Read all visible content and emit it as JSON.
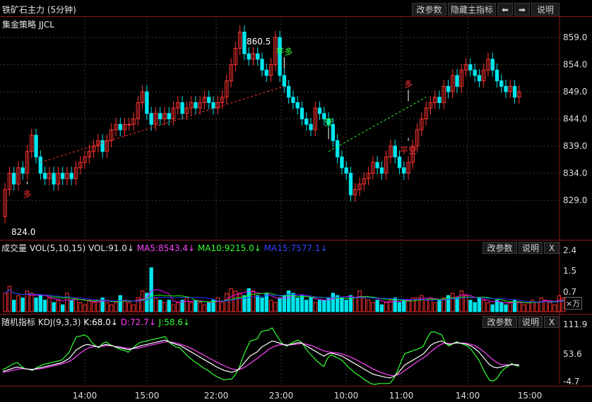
{
  "header": {
    "title": "铁矿石主力 (5分钟)",
    "change_params": "改参数",
    "hide_main": "隐藏主指标",
    "left_arrow": "⬅",
    "right_arrow": "➡",
    "help": "说明"
  },
  "main": {
    "strategy": "集金策略 JJCL",
    "high_label": "860.5",
    "low_label": "824.0",
    "signals": [
      "平多",
      "空",
      "多",
      "平空",
      "多"
    ]
  },
  "volume": {
    "title": "成交量",
    "indicator": "VOL(5,10,15)",
    "vol": "VOL:91.0↓",
    "ma5": "MA5:8543.4↓",
    "ma10": "MA10:9215.0↓",
    "ma15": "MA15:7577.1↓",
    "change_params": "改参数",
    "help": "说明",
    "close": "X",
    "unit": "×万",
    "y_ticks": [
      "2.4",
      "1.5",
      "0.7"
    ]
  },
  "kdj": {
    "title": "随机指标",
    "indicator": "KDJ(9,3,3)",
    "k": "K:68.0↓",
    "d": "D:72.7↓",
    "j": "J:58.6↓",
    "change_params": "改参数",
    "help": "说明",
    "close": "X",
    "y_ticks": [
      "111.9",
      "53.6",
      "-4.7"
    ]
  },
  "colors": {
    "up": "#ff3232",
    "down": "#00e5ee",
    "ma5": "#ff00ff",
    "ma10": "#00ff00",
    "ma15": "#2233ff",
    "k": "#ffffff",
    "d": "#ff44ff",
    "j": "#33ff33",
    "signal_long": "#ff3232",
    "signal_short": "#33ff33"
  },
  "chart_data": {
    "type": "candlestick",
    "x_tick_labels": [
      "14:00",
      "15:00",
      "22:00",
      "23:00",
      "10:00",
      "11:00",
      "14:00",
      "15:00"
    ],
    "y_tick_labels": [
      "859.0",
      "854.0",
      "849.0",
      "844.0",
      "839.0",
      "834.0",
      "829.0"
    ],
    "ylim": [
      822,
      862
    ],
    "candles": [
      [
        826,
        831
      ],
      [
        831,
        834
      ],
      [
        834,
        832
      ],
      [
        832,
        835
      ],
      [
        835,
        834
      ],
      [
        834,
        838
      ],
      [
        838,
        841
      ],
      [
        841,
        837
      ],
      [
        837,
        834
      ],
      [
        834,
        833
      ],
      [
        833,
        834
      ],
      [
        834,
        832
      ],
      [
        832,
        834
      ],
      [
        834,
        833
      ],
      [
        833,
        834
      ],
      [
        834,
        833
      ],
      [
        833,
        835
      ],
      [
        835,
        836
      ],
      [
        836,
        837
      ],
      [
        837,
        838
      ],
      [
        838,
        839
      ],
      [
        839,
        840
      ],
      [
        840,
        838
      ],
      [
        838,
        840
      ],
      [
        840,
        842
      ],
      [
        842,
        843
      ],
      [
        843,
        842
      ],
      [
        842,
        843
      ],
      [
        843,
        843
      ],
      [
        843,
        844
      ],
      [
        844,
        847
      ],
      [
        847,
        849
      ],
      [
        849,
        845
      ],
      [
        845,
        843
      ],
      [
        843,
        845
      ],
      [
        845,
        844
      ],
      [
        844,
        845
      ],
      [
        845,
        844
      ],
      [
        844,
        846
      ],
      [
        846,
        847
      ],
      [
        847,
        845
      ],
      [
        845,
        846
      ],
      [
        846,
        847
      ],
      [
        847,
        846
      ],
      [
        846,
        847
      ],
      [
        847,
        848
      ],
      [
        848,
        847
      ],
      [
        847,
        846
      ],
      [
        846,
        847
      ],
      [
        847,
        848
      ],
      [
        848,
        851
      ],
      [
        851,
        854
      ],
      [
        854,
        857
      ],
      [
        857,
        860
      ],
      [
        860,
        856
      ],
      [
        856,
        855
      ],
      [
        855,
        856
      ],
      [
        856,
        855
      ],
      [
        855,
        853
      ],
      [
        853,
        852
      ],
      [
        852,
        854
      ],
      [
        854,
        859
      ],
      [
        859,
        852
      ],
      [
        852,
        850
      ],
      [
        850,
        848
      ],
      [
        848,
        847
      ],
      [
        847,
        846
      ],
      [
        846,
        844
      ],
      [
        844,
        843
      ],
      [
        843,
        842
      ],
      [
        842,
        846
      ],
      [
        846,
        845
      ],
      [
        845,
        844
      ],
      [
        844,
        843
      ],
      [
        843,
        840
      ],
      [
        840,
        837
      ],
      [
        837,
        835
      ],
      [
        835,
        834
      ],
      [
        834,
        830
      ],
      [
        830,
        831
      ],
      [
        831,
        832
      ],
      [
        832,
        833
      ],
      [
        833,
        834
      ],
      [
        834,
        836
      ],
      [
        836,
        835
      ],
      [
        835,
        834
      ],
      [
        834,
        837
      ],
      [
        837,
        839
      ],
      [
        839,
        837
      ],
      [
        837,
        835
      ],
      [
        835,
        834
      ],
      [
        834,
        836
      ],
      [
        836,
        839
      ],
      [
        839,
        842
      ],
      [
        842,
        844
      ],
      [
        844,
        846
      ],
      [
        846,
        847
      ],
      [
        847,
        848
      ],
      [
        848,
        847
      ],
      [
        847,
        850
      ],
      [
        850,
        849
      ],
      [
        849,
        852
      ],
      [
        852,
        850
      ],
      [
        850,
        853
      ],
      [
        853,
        854
      ],
      [
        854,
        853
      ],
      [
        853,
        852
      ],
      [
        852,
        851
      ],
      [
        851,
        853
      ],
      [
        853,
        855
      ],
      [
        855,
        853
      ],
      [
        853,
        851
      ],
      [
        851,
        850
      ],
      [
        850,
        849
      ],
      [
        849,
        850
      ],
      [
        850,
        848
      ],
      [
        848,
        849
      ]
    ],
    "kdj_k": [
      20,
      22,
      25,
      28,
      30,
      28,
      26,
      25,
      24,
      26,
      28,
      30,
      32,
      34,
      36,
      38,
      40,
      45,
      50,
      60,
      70,
      75,
      80,
      82,
      80,
      78,
      76,
      80,
      82,
      80,
      78,
      76,
      74,
      72,
      70,
      72,
      75,
      78,
      80,
      82,
      84,
      86,
      88,
      90,
      92,
      88,
      85,
      82,
      80,
      75,
      70,
      65,
      60,
      55,
      50,
      45,
      40,
      35,
      30,
      26,
      22,
      20,
      18,
      20,
      25,
      35,
      45,
      55,
      60,
      65,
      75,
      80,
      85,
      90,
      88,
      85,
      82,
      80,
      82,
      84,
      86,
      85,
      80,
      75,
      70,
      65,
      60,
      55,
      60,
      62,
      60,
      58,
      55,
      50,
      45,
      40,
      35,
      30,
      25,
      20,
      15,
      12,
      10,
      8,
      6,
      5,
      8,
      15,
      25,
      35,
      40,
      45,
      50,
      55,
      60,
      70,
      80,
      85,
      88,
      90,
      85,
      82,
      84,
      86,
      85,
      84,
      82,
      78,
      72,
      65,
      55,
      45,
      35,
      30,
      28,
      30,
      32,
      34,
      36,
      35,
      34
    ],
    "kdj_d": [
      18,
      19,
      21,
      23,
      25,
      26,
      26,
      25,
      25,
      25,
      26,
      27,
      29,
      31,
      33,
      35,
      37,
      40,
      43,
      48,
      55,
      62,
      68,
      73,
      76,
      77,
      77,
      78,
      79,
      79,
      78,
      77,
      76,
      74,
      73,
      72,
      73,
      74,
      76,
      78,
      80,
      82,
      84,
      86,
      88,
      88,
      87,
      85,
      83,
      80,
      77,
      73,
      69,
      64,
      60,
      55,
      50,
      46,
      41,
      37,
      33,
      29,
      26,
      24,
      24,
      27,
      32,
      38,
      44,
      50,
      57,
      63,
      70,
      75,
      79,
      81,
      82,
      81,
      81,
      82,
      83,
      84,
      83,
      81,
      78,
      75,
      71,
      67,
      65,
      64,
      63,
      62,
      60,
      57,
      54,
      50,
      46,
      41,
      37,
      32,
      27,
      23,
      19,
      16,
      13,
      11,
      10,
      12,
      16,
      22,
      28,
      34,
      40,
      46,
      51,
      57,
      65,
      72,
      78,
      83,
      85,
      84,
      84,
      85,
      85,
      85,
      84,
      82,
      79,
      74,
      68,
      61,
      53,
      46,
      40,
      36,
      35,
      35,
      35,
      36,
      35
    ],
    "kdj_j": [
      24,
      28,
      33,
      38,
      40,
      32,
      26,
      25,
      22,
      28,
      32,
      36,
      38,
      40,
      42,
      44,
      46,
      55,
      64,
      84,
      100,
      101,
      104,
      100,
      88,
      80,
      74,
      84,
      88,
      82,
      78,
      74,
      70,
      68,
      64,
      72,
      79,
      86,
      88,
      90,
      92,
      94,
      96,
      98,
      100,
      88,
      81,
      76,
      74,
      65,
      56,
      49,
      42,
      37,
      30,
      25,
      20,
      13,
      8,
      4,
      0,
      2,
      2,
      12,
      27,
      51,
      71,
      89,
      92,
      95,
      111,
      114,
      115,
      120,
      106,
      93,
      82,
      78,
      84,
      88,
      92,
      87,
      74,
      63,
      54,
      45,
      38,
      31,
      50,
      58,
      54,
      50,
      45,
      36,
      27,
      20,
      13,
      8,
      1,
      -4,
      -9,
      -10,
      -8,
      -8,
      -8,
      -7,
      4,
      21,
      43,
      61,
      64,
      67,
      70,
      73,
      78,
      96,
      110,
      111,
      108,
      104,
      85,
      78,
      84,
      88,
      85,
      82,
      78,
      70,
      58,
      47,
      29,
      13,
      -1,
      -2,
      4,
      18,
      26,
      32,
      38,
      33,
      32
    ],
    "kdj_ylim": [
      -10,
      120
    ],
    "volume_levels": [
      0.8,
      1.1,
      0.5,
      0.7,
      0.6,
      0.9,
      0.8,
      0.6,
      0.7,
      0.5,
      0.6,
      0.4,
      0.5,
      0.3,
      0.8,
      0.5,
      0.6,
      0.4,
      0.3,
      0.5,
      0.4,
      0.5,
      0.6,
      0.4,
      0.3,
      0.4,
      0.7,
      0.5,
      0.4,
      0.3,
      0.6,
      0.9,
      0.8,
      1.9,
      0.6,
      0.5,
      0.4,
      0.5,
      0.3,
      0.4,
      0.5,
      0.6,
      0.4,
      0.5,
      0.4,
      0.3,
      0.4,
      0.5,
      0.6,
      0.4,
      0.8,
      1.0,
      0.9,
      0.8,
      0.7,
      1.0,
      0.9,
      0.7,
      0.6,
      0.8,
      0.5,
      0.4,
      0.6,
      0.7,
      0.9,
      0.8,
      0.6,
      0.7,
      0.5,
      0.6,
      0.4,
      0.5,
      0.5,
      0.6,
      0.8,
      0.7,
      0.6,
      0.5,
      0.7,
      0.6,
      0.9,
      0.6,
      0.5,
      0.4,
      0.5,
      0.3,
      0.4,
      0.5,
      0.6,
      0.4,
      0.5,
      0.5,
      0.6,
      0.6,
      0.7,
      0.5,
      0.6,
      0.4,
      0.5,
      0.6,
      0.7,
      0.8,
      0.6,
      0.9,
      0.7,
      0.5,
      0.4,
      0.6,
      0.5,
      0.4,
      0.3,
      0.5,
      0.4,
      0.3,
      0.4,
      0.5,
      0.4,
      0.3,
      0.4,
      0.5,
      0.4,
      0.6,
      0.5,
      0.4,
      0.3,
      0.7,
      0.6
    ],
    "volume_ylim": [
      0,
      2.5
    ]
  }
}
